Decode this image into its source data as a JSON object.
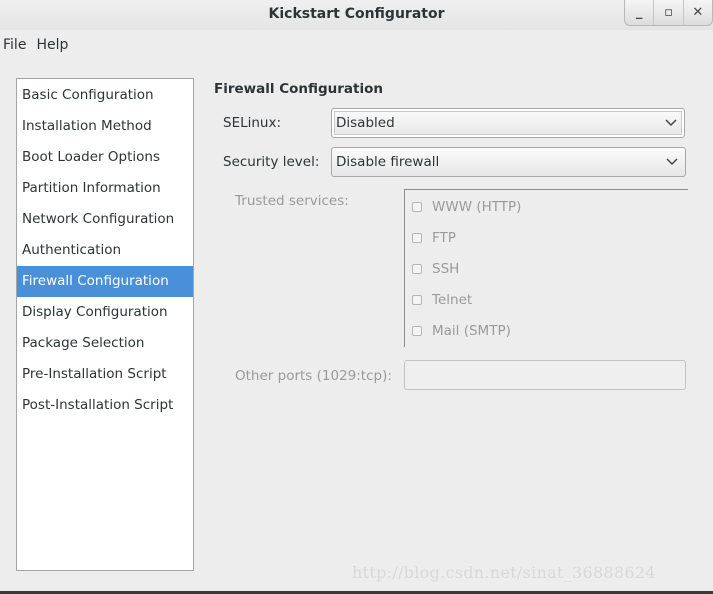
{
  "window": {
    "title": "Kickstart Configurator",
    "controls": {
      "minimize": "_",
      "maximize": "▫",
      "close": "✕"
    }
  },
  "menubar": {
    "items": [
      "File",
      "Help"
    ]
  },
  "sidebar": {
    "selected_index": 6,
    "items": [
      {
        "label": "Basic Configuration"
      },
      {
        "label": "Installation Method"
      },
      {
        "label": "Boot Loader Options"
      },
      {
        "label": "Partition Information"
      },
      {
        "label": "Network Configuration"
      },
      {
        "label": "Authentication"
      },
      {
        "label": "Firewall Configuration"
      },
      {
        "label": "Display Configuration"
      },
      {
        "label": "Package Selection"
      },
      {
        "label": "Pre-Installation Script"
      },
      {
        "label": "Post-Installation Script"
      }
    ]
  },
  "firewall": {
    "title": "Firewall Configuration",
    "selinux_label": "SELinux:",
    "selinux_value": "Disabled",
    "security_label": "Security level:",
    "security_value": "Disable firewall",
    "trusted_label": "Trusted services:",
    "services": [
      {
        "label": "WWW (HTTP)",
        "checked": false
      },
      {
        "label": "FTP",
        "checked": false
      },
      {
        "label": "SSH",
        "checked": false
      },
      {
        "label": "Telnet",
        "checked": false
      },
      {
        "label": "Mail (SMTP)",
        "checked": false
      }
    ],
    "other_ports_label": "Other ports (1029:tcp):",
    "other_ports_value": ""
  },
  "watermark": "http://blog.csdn.net/sinat_36888624",
  "colors": {
    "selection": "#4a90d9",
    "disabled_text": "#9a9a9a"
  }
}
